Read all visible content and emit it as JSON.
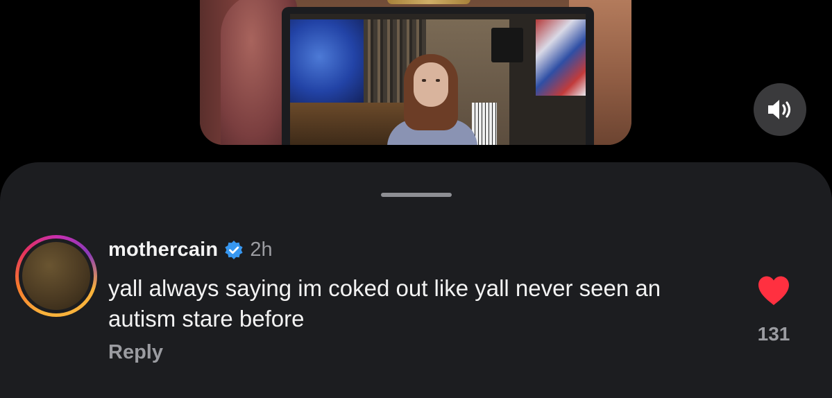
{
  "video": {
    "volume_icon": "speaker-on-icon"
  },
  "comment": {
    "username": "mothercain",
    "verified_icon": "verified-badge-icon",
    "timestamp": "2h",
    "text": "yall always saying im coked out like yall never seen an autism stare before",
    "reply_label": "Reply",
    "like_icon": "heart-filled-icon",
    "like_count": "131"
  },
  "colors": {
    "background": "#000000",
    "sheet": "#1c1d20",
    "primary_text": "#f3f3f3",
    "secondary_text": "#9b9ca1",
    "verified": "#3797f0",
    "like": "#ff3040"
  }
}
